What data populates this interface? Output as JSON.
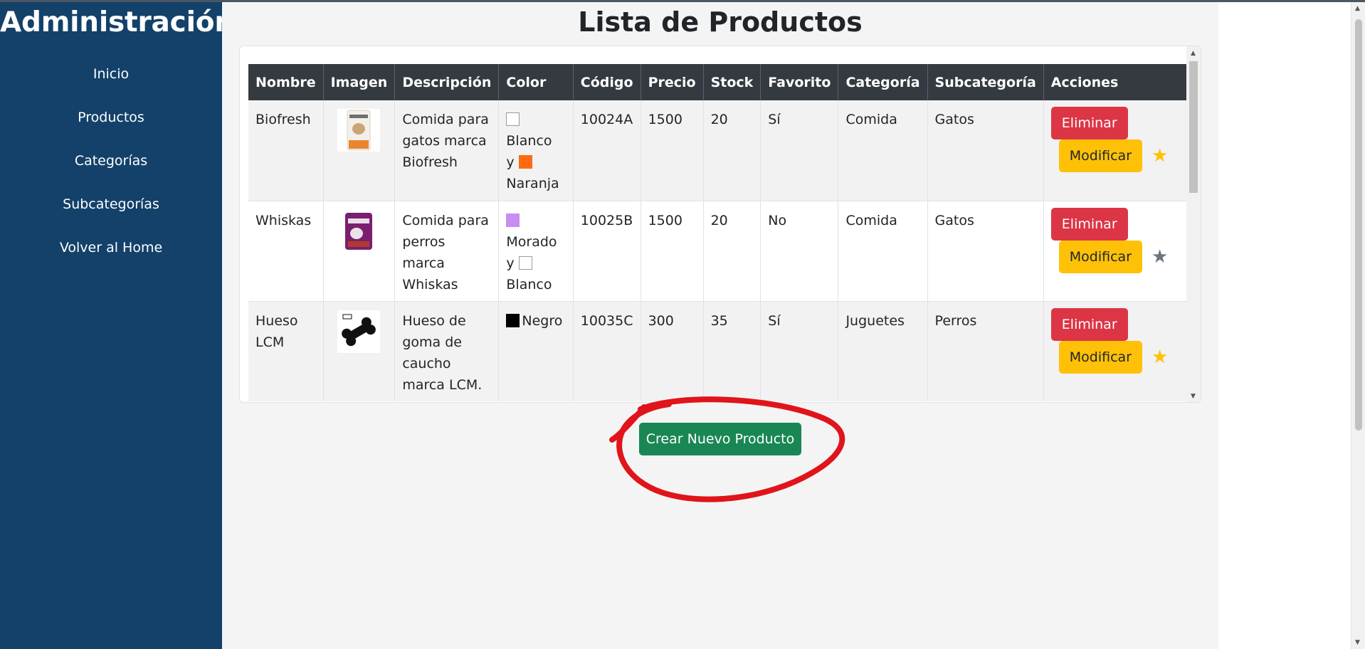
{
  "sidebar": {
    "title": "Administración",
    "items": [
      {
        "label": "Inicio"
      },
      {
        "label": "Productos"
      },
      {
        "label": "Categorías"
      },
      {
        "label": "Subcategorías"
      },
      {
        "label": "Volver al Home"
      }
    ]
  },
  "main": {
    "title": "Lista de Productos",
    "table": {
      "headers": [
        "Nombre",
        "Imagen",
        "Descripción",
        "Color",
        "Código",
        "Precio",
        "Stock",
        "Favorito",
        "Categoría",
        "Subcategoría",
        "Acciones"
      ],
      "rows": [
        {
          "nombre": "Biofresh",
          "descripcion": "Comida para gatos marca Biofresh",
          "color": {
            "c1": "Blanco",
            "sep": "y",
            "c2": "Naranja",
            "c1_hex": "#ffffff",
            "c2_hex": "#ff6a13"
          },
          "codigo": "10024A",
          "precio": "1500",
          "stock": "20",
          "favorito": "Sí",
          "categoria": "Comida",
          "subcategoria": "Gatos",
          "star_color": "#ffc107"
        },
        {
          "nombre": "Whiskas",
          "descripcion": "Comida para perros marca Whiskas",
          "color": {
            "c1": "Morado",
            "sep": "y",
            "c2": "Blanco",
            "c1_hex": "#c98cf2",
            "c2_hex": "#ffffff"
          },
          "codigo": "10025B",
          "precio": "1500",
          "stock": "20",
          "favorito": "No",
          "categoria": "Comida",
          "subcategoria": "Gatos",
          "star_color": "#6c757d"
        },
        {
          "nombre": "Hueso LCM",
          "descripcion": "Hueso de goma de caucho marca LCM.",
          "color": {
            "c1": "Negro",
            "c1_hex": "#000000"
          },
          "codigo": "10035C",
          "precio": "300",
          "stock": "35",
          "favorito": "Sí",
          "categoria": "Juguetes",
          "subcategoria": "Perros",
          "star_color": "#ffc107"
        }
      ],
      "actions": {
        "delete_label": "Eliminar",
        "edit_label": "Modificar",
        "favorite_icon": "star-icon"
      }
    },
    "create_button_label": "Crear Nuevo Producto"
  },
  "colors": {
    "sidebar_bg": "#13416a",
    "table_header_bg": "#343a40",
    "danger": "#dc3545",
    "warning": "#ffc107",
    "success": "#198754",
    "annotation": "#e0141b"
  }
}
